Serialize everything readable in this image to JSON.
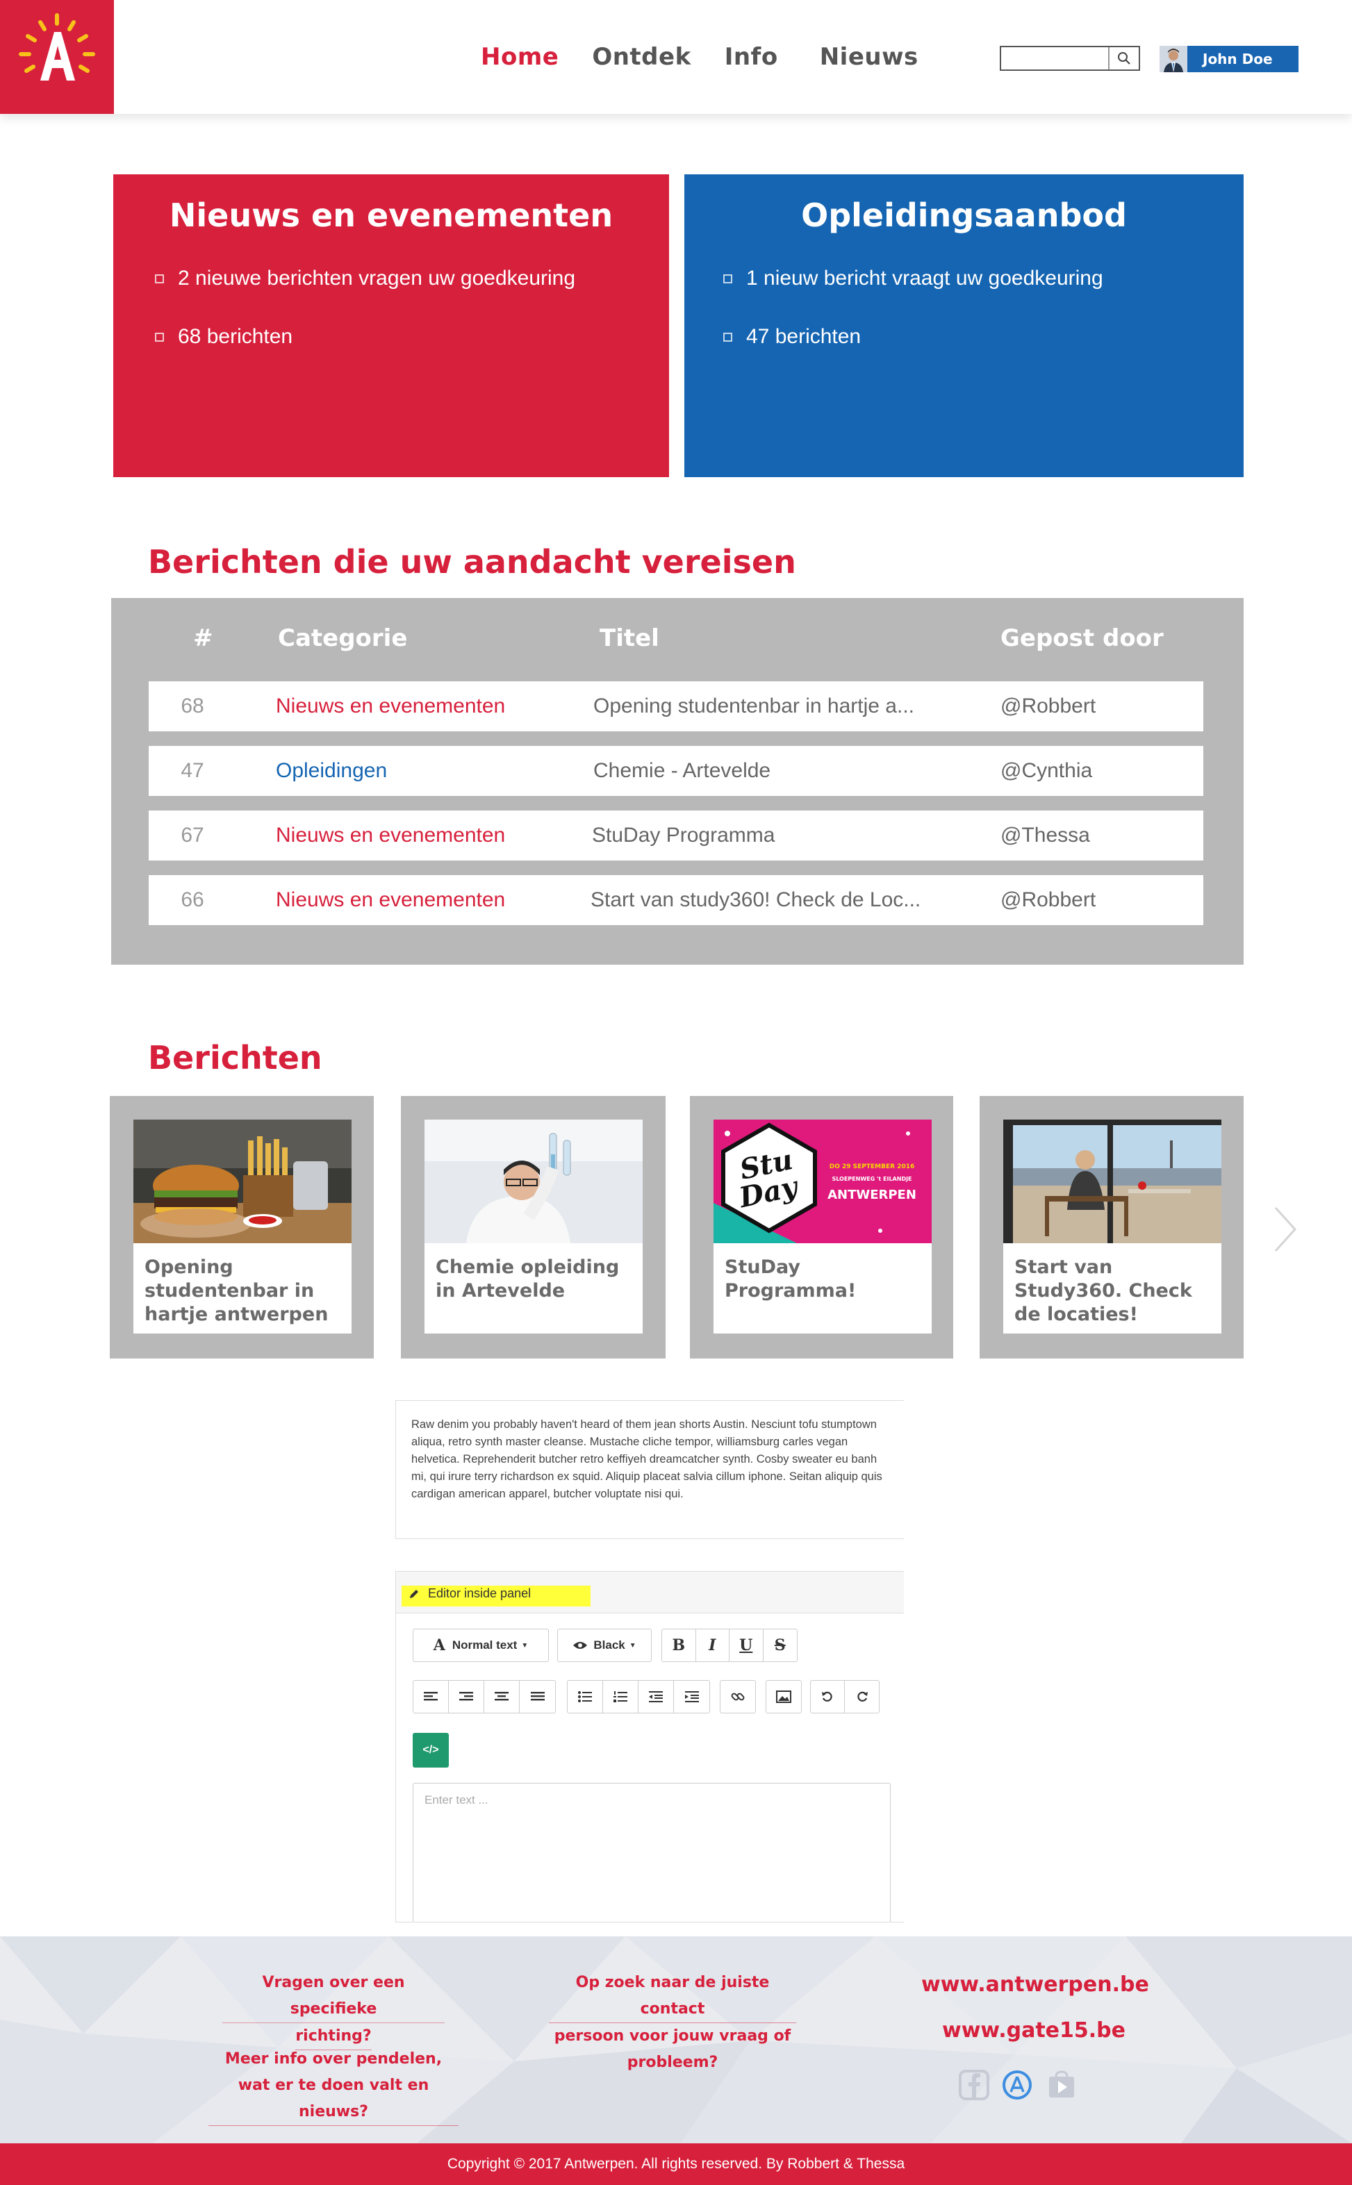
{
  "header": {
    "nav": [
      "Home",
      "Ontdek",
      "Info",
      "Nieuws"
    ],
    "search_placeholder": "",
    "user_name": "John Doe"
  },
  "panels": {
    "red": {
      "title": "Nieuws en evenementen",
      "items": [
        "2 nieuwe berichten vragen uw goedkeuring",
        "68 berichten"
      ]
    },
    "blue": {
      "title": "Opleidingsaanbod",
      "items": [
        "1 nieuw bericht vraagt uw goedkeuring",
        "47 berichten"
      ]
    }
  },
  "attention": {
    "title": "Berichten die uw aandacht vereisen",
    "columns": [
      "#",
      "Categorie",
      "Titel",
      "Gepost door"
    ],
    "rows": [
      {
        "num": "68",
        "category": "Nieuws en evenementen",
        "title": "Opening studentenbar in hartje a...",
        "user": "@Robbert"
      },
      {
        "num": "47",
        "category": "Opleidingen",
        "title": "Chemie - Artevelde",
        "user": "@Cynthia"
      },
      {
        "num": "67",
        "category": "Nieuws en evenementen",
        "title": "StuDay Programma",
        "user": "@Thessa"
      },
      {
        "num": "66",
        "category": "Nieuws en evenementen",
        "title": "Start van study360! Check de Loc...",
        "user": "@Robbert"
      }
    ]
  },
  "berichten": {
    "title": "Berichten",
    "cards": [
      {
        "title": "Opening studentenbar in hartje antwerpen"
      },
      {
        "title": "Chemie opleiding in Artevelde"
      },
      {
        "title": "StuDay Programma!",
        "poster": {
          "logo_line1": "Stu",
          "logo_line2": "Day",
          "date": "DO 29 SEPTEMBER 2016",
          "place": "SLOEPENWEG 't EILANDJE",
          "city": "ANTWERPEN"
        }
      },
      {
        "title": "Start van Study360. Check de locaties!"
      }
    ]
  },
  "textblock": "Raw denim you probably haven't heard of them jean shorts Austin. Nesciunt tofu stumptown aliqua, retro synth master cleanse. Mustache cliche tempor, williamsburg carles vegan helvetica. Reprehenderit butcher retro keffiyeh dreamcatcher synth. Cosby sweater eu banh mi, qui irure terry richardson ex squid. Aliquip placeat salvia cillum iphone. Seitan aliquip quis cardigan american apparel, butcher voluptate nisi qui.",
  "editor": {
    "header_label": "Editor inside panel",
    "font_dropdown": "Normal text",
    "color_dropdown": "Black",
    "format_buttons": [
      "B",
      "I",
      "U",
      "S"
    ],
    "code_button": "</>",
    "placeholder": "Enter text ..."
  },
  "footer": {
    "links": [
      "Vragen over een specifieke richting?",
      "Meer info over pendelen, wat er te doen valt en nieuws?",
      "Op zoek naar de juiste contact persoon voor jouw vraag of probleem?"
    ],
    "link_lines": {
      "l1a": "Vragen over een specifieke",
      "l1b": "richting?",
      "l2a": "Meer info over pendelen,",
      "l2b": "wat er te doen valt en nieuws?",
      "l3a": "Op zoek naar de juiste contact",
      "l3b": "persoon voor jouw vraag of",
      "l3c": "probleem?"
    },
    "sites": [
      "www.antwerpen.be",
      "www.gate15.be"
    ],
    "social_icons": [
      "facebook-icon",
      "app-store-icon",
      "google-play-icon"
    ],
    "copyright": "Copyright © 2017 Antwerpen. All rights reserved. By Robbert & Thessa"
  },
  "colors": {
    "brand_red": "#d7203c",
    "brand_blue": "#1565b2",
    "table_gray": "#b8b8b8",
    "code_green": "#1f9a6e"
  }
}
